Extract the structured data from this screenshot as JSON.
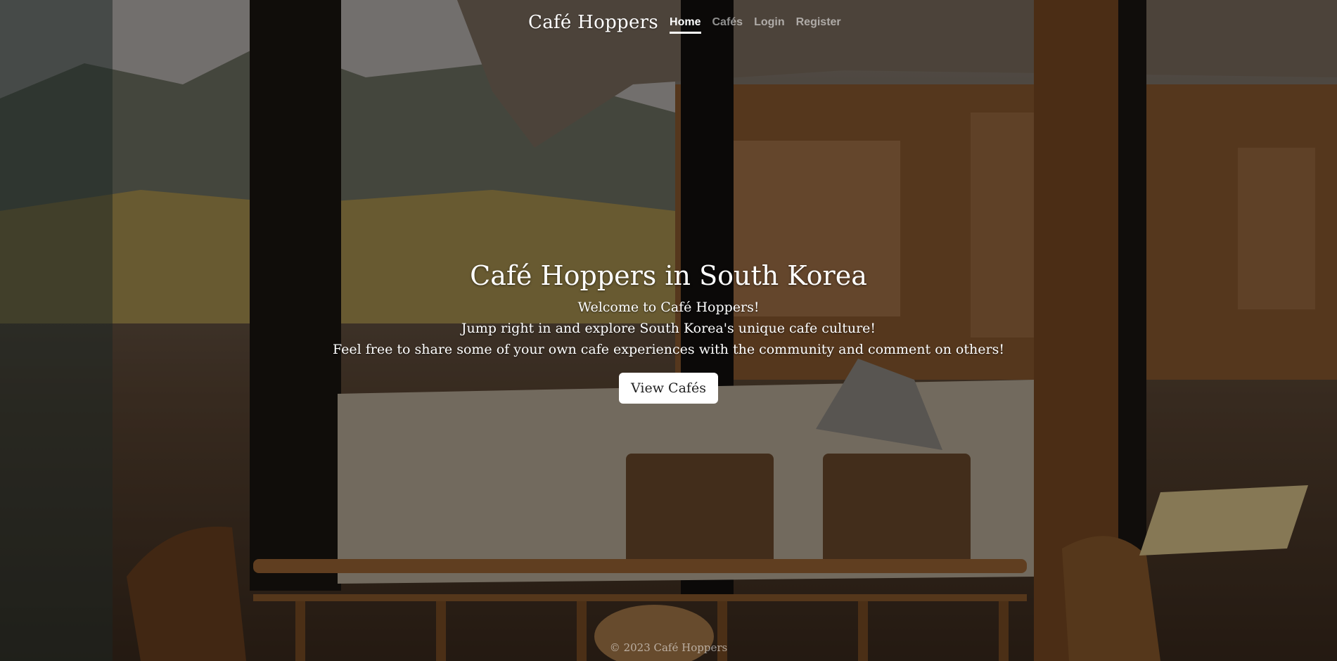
{
  "nav": {
    "brand": "Café Hoppers",
    "links": [
      {
        "label": "Home",
        "active": true
      },
      {
        "label": "Cafés",
        "active": false
      },
      {
        "label": "Login",
        "active": false
      },
      {
        "label": "Register",
        "active": false
      }
    ]
  },
  "hero": {
    "title": "Café Hoppers in South Korea",
    "line1": "Welcome to Café Hoppers!",
    "line2": "Jump right in and explore South Korea's unique cafe culture!",
    "line3": "Feel free to share some of your own cafe experiences with the community and comment on others!",
    "button": "View Cafés"
  },
  "footer": {
    "text": "© 2023 Café Hoppers"
  }
}
